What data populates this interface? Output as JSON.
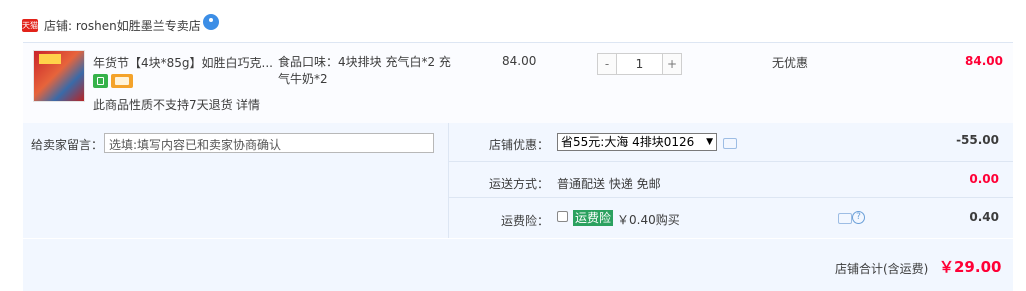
{
  "shop": {
    "badge": "天猫",
    "label": "店铺: roshen如胜墨兰专卖店"
  },
  "item": {
    "title": "年货节【4块*85g】如胜白巧克...",
    "no_return": "此商品性质不支持7天退货",
    "detail_link": "详情",
    "sku": "食品口味：4块排块 充气白*2 充气牛奶*2",
    "price": "84.00",
    "quantity": "1",
    "minus": "-",
    "plus": "+",
    "discount": "无优惠",
    "total": "84.00"
  },
  "memo": {
    "label": "给卖家留言：",
    "placeholder": "选填:填写内容已和卖家协商确认"
  },
  "summary": {
    "shop_discount_label": "店铺优惠：",
    "shop_discount_selected": "省55元:大海 4排块0126",
    "shop_discount_value": "-55.00",
    "shipping_label": "运送方式：",
    "shipping_method": "普通配送 快递 免邮",
    "shipping_value": "0.00",
    "insurance_label": "运费险：",
    "insurance_tag": "运费险",
    "insurance_price": "￥0.40购买",
    "insurance_value": "0.40",
    "help_q": "?"
  },
  "total": {
    "label": "店铺合计(含运费)",
    "value": "￥29.00"
  }
}
